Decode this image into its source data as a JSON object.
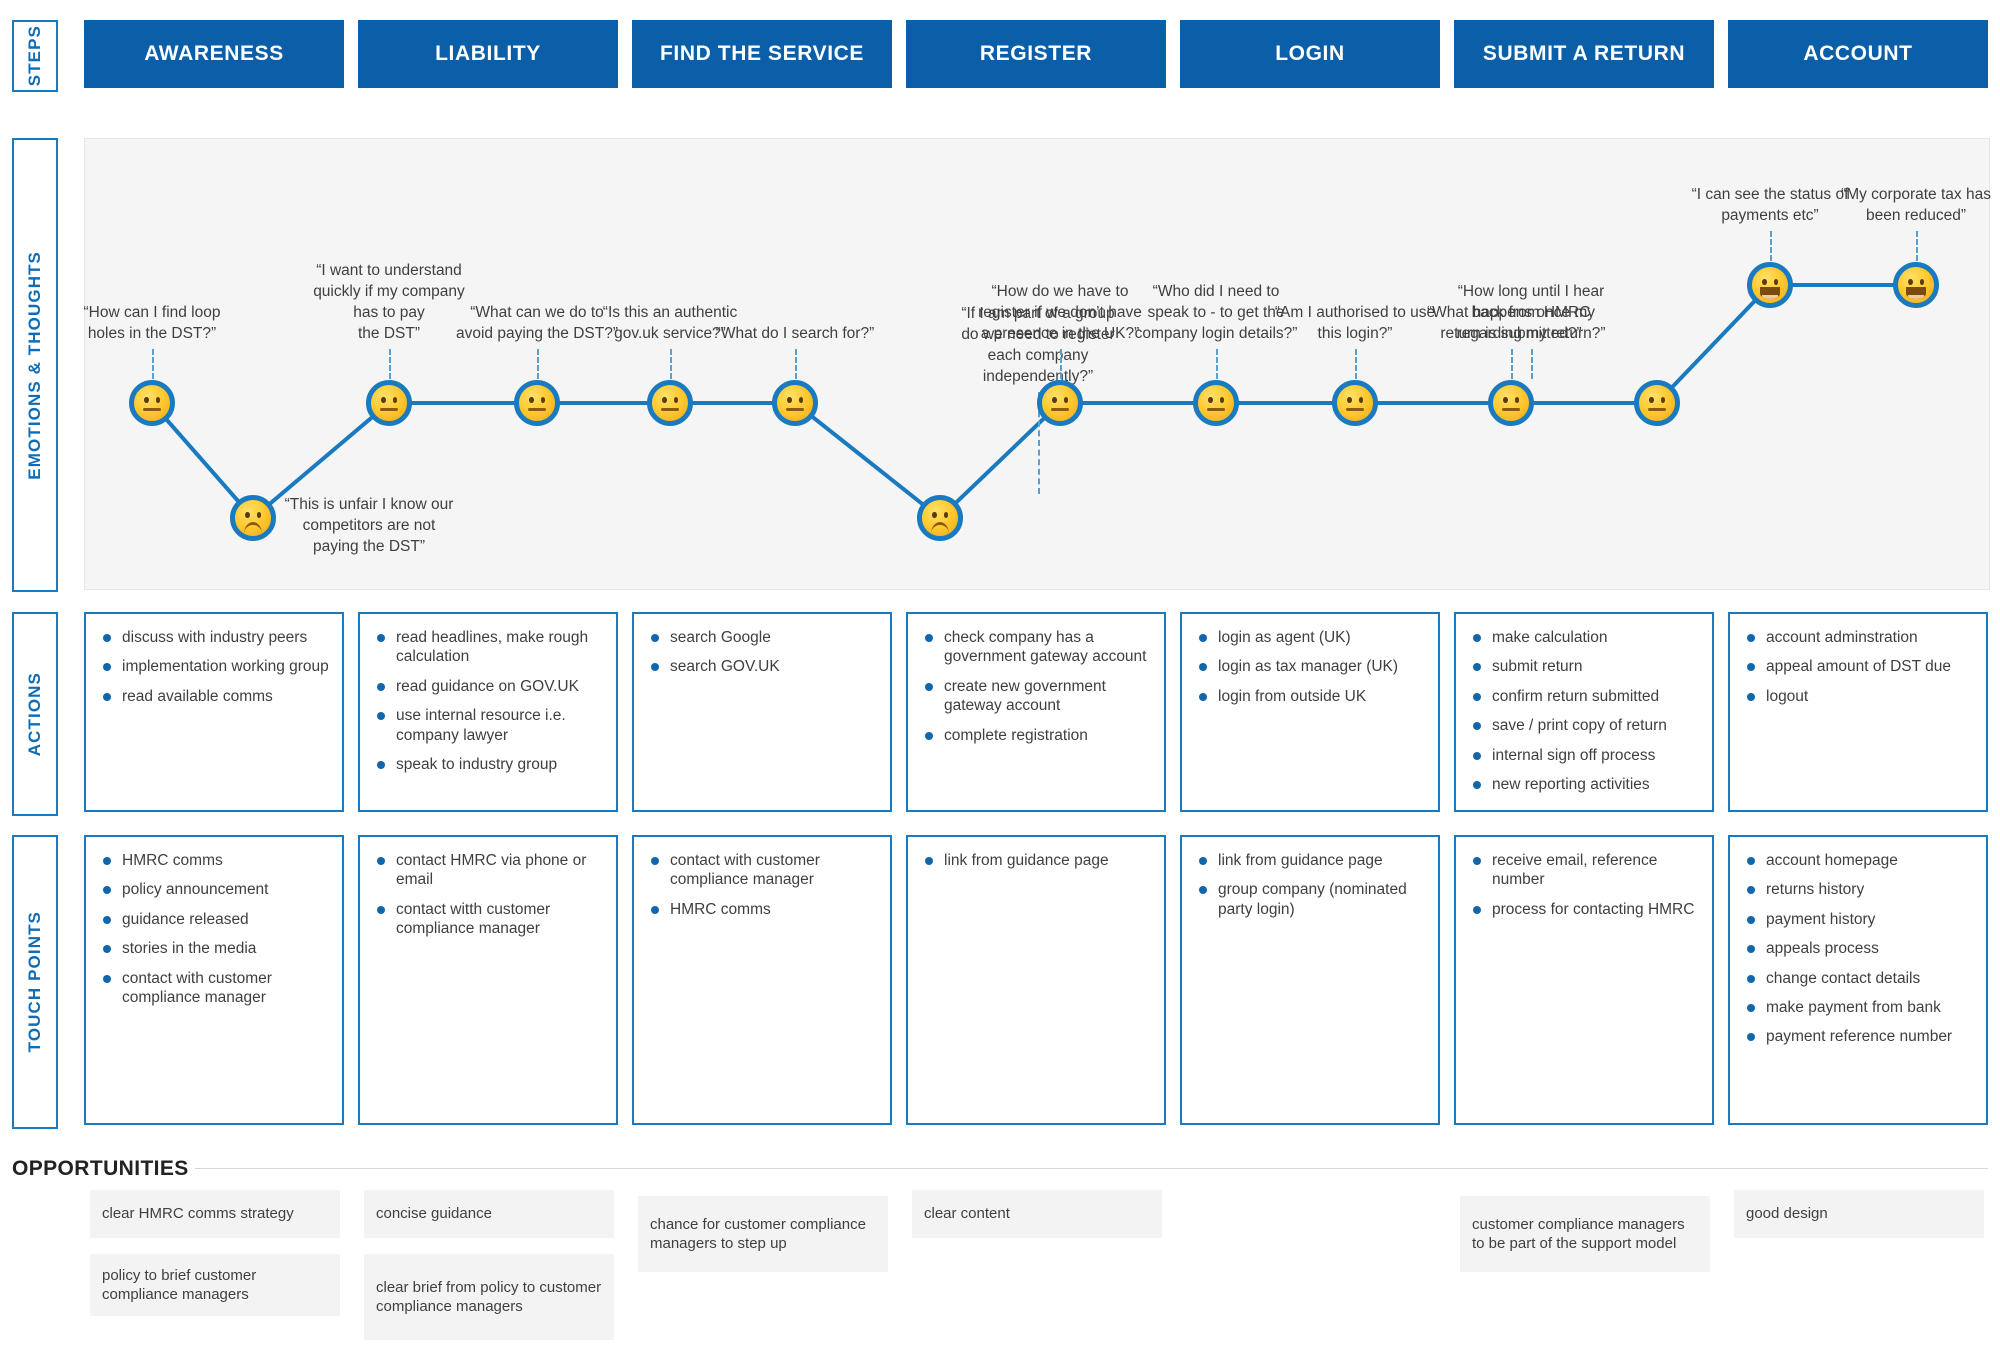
{
  "theme": {
    "brand_blue": "#0b5ea8",
    "accent_blue": "#1a7abf",
    "panel_grey": "#f5f5f5",
    "chip_grey": "#f3f3f3"
  },
  "rows": {
    "steps_label": "STEPS",
    "emotions_label": "EMOTIONS & THOUGHTS",
    "actions_label": "ACTIONS",
    "touchpoints_label": "TOUCH POINTS",
    "opportunities_label": "OPPORTUNITIES"
  },
  "steps": [
    {
      "label": "AWARENESS"
    },
    {
      "label": "LIABILITY"
    },
    {
      "label": "FIND THE SERVICE"
    },
    {
      "label": "REGISTER"
    },
    {
      "label": "LOGIN"
    },
    {
      "label": "SUBMIT A RETURN"
    },
    {
      "label": "ACCOUNT"
    }
  ],
  "emotions": {
    "points": [
      {
        "mood": "neutral",
        "quote": "“How can I find loop\nholes in the DST?”",
        "quote_pos": "above"
      },
      {
        "mood": "sad",
        "quote": "“This is unfair I know our\ncompetitors are not\npaying the DST”",
        "quote_pos": "above"
      },
      {
        "mood": "neutral",
        "quote": "“I want to understand\nquickly if my company\nhas to pay\nthe DST”",
        "quote_pos": "above"
      },
      {
        "mood": "neutral",
        "quote": "“What can we do to\navoid paying the DST?”",
        "quote_pos": "above"
      },
      {
        "mood": "neutral",
        "quote": "“Is this an authentic\ngov.uk service?”",
        "quote_pos": "above"
      },
      {
        "mood": "neutral",
        "quote": "“What do I search for?”",
        "quote_pos": "above"
      },
      {
        "mood": "sad",
        "quote": "“If I am part of a group\ndo we need to register\neach company\nindependently?”",
        "quote_pos": "above"
      },
      {
        "mood": "neutral",
        "quote": "“How do we have to\nregister if we don’t have\na presence in the UK?”",
        "quote_pos": "above"
      },
      {
        "mood": "neutral",
        "quote": "“Who did I need to\nspeak to - to get the\ncompany login details?”",
        "quote_pos": "above"
      },
      {
        "mood": "neutral",
        "quote": "“Am I authorised to use\nthis login?”",
        "quote_pos": "above"
      },
      {
        "mood": "neutral",
        "quote": "“What happens once my\nreturn is submitted?”",
        "quote_pos": "above"
      },
      {
        "mood": "neutral",
        "quote": "“How long until I hear\nback from HMRC\nregarding my return?”",
        "quote_pos": "above"
      },
      {
        "mood": "happy",
        "quote": "“I can see the status of\npayments etc”",
        "quote_pos": "above"
      },
      {
        "mood": "happy",
        "quote": "“My corporate tax has\nbeen reduced”",
        "quote_pos": "above"
      }
    ]
  },
  "actions": [
    {
      "items": [
        "discuss with industry peers",
        "implementation working group",
        "read available comms"
      ]
    },
    {
      "items": [
        "read headlines, make rough calculation",
        "read guidance on GOV.UK",
        "use internal resource i.e. company lawyer",
        "speak to industry group"
      ]
    },
    {
      "items": [
        "search Google",
        "search GOV.UK"
      ]
    },
    {
      "items": [
        "check company has a government gateway account",
        "create new government gateway account",
        "complete registration"
      ]
    },
    {
      "items": [
        "login as agent (UK)",
        "login as tax manager (UK)",
        "login from outside UK"
      ]
    },
    {
      "items": [
        "make calculation",
        "submit return",
        "confirm return submitted",
        "save / print copy of return",
        "internal sign off process",
        "new reporting activities"
      ]
    },
    {
      "items": [
        "account adminstration",
        "appeal amount of DST due",
        "logout"
      ]
    }
  ],
  "touchpoints": [
    {
      "items": [
        "HMRC comms",
        "policy announcement",
        "guidance released",
        "stories in the media",
        "contact with customer compliance manager"
      ]
    },
    {
      "items": [
        "contact HMRC via phone or email",
        "contact witth customer compliance manager"
      ]
    },
    {
      "items": [
        "contact with customer compliance manager",
        "HMRC comms"
      ]
    },
    {
      "items": [
        "link from guidance page"
      ]
    },
    {
      "items": [
        "link from guidance page",
        "group company (nominated party login)"
      ]
    },
    {
      "items": [
        "receive email, reference number",
        "process for contacting HMRC"
      ]
    },
    {
      "items": [
        "account homepage",
        "returns history",
        "payment history",
        "appeals process",
        "change contact details",
        "make payment from bank",
        "payment reference number"
      ]
    }
  ],
  "opportunities": [
    {
      "col": 0,
      "row": 0,
      "text": "clear HMRC comms strategy"
    },
    {
      "col": 0,
      "row": 1,
      "text": "policy to brief customer compliance managers"
    },
    {
      "col": 1,
      "row": 0,
      "text": "concise guidance"
    },
    {
      "col": 1,
      "row": 1,
      "text": "clear brief from policy to customer compliance managers"
    },
    {
      "col": 2,
      "row": 0,
      "text": "chance for customer compliance managers to step up"
    },
    {
      "col": 3,
      "row": 0,
      "text": "clear content"
    },
    {
      "col": 5,
      "row": 0,
      "text": "customer compliance managers to be part of the support model"
    },
    {
      "col": 6,
      "row": 0,
      "text": "good design"
    }
  ]
}
